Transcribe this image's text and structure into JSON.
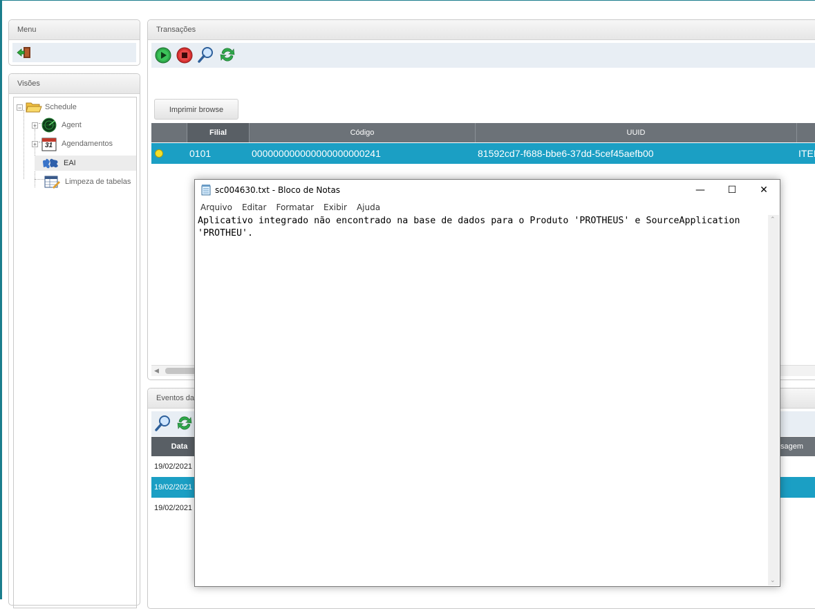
{
  "menu": {
    "title": "Menu"
  },
  "visoes": {
    "title": "Visões",
    "tree": [
      {
        "label": "Schedule",
        "icon": "folder-icon"
      },
      {
        "label": "Agent",
        "icon": "radar-icon"
      },
      {
        "label": "Agendamentos",
        "icon": "calendar-icon"
      },
      {
        "label": "EAI",
        "icon": "puzzle-icon"
      },
      {
        "label": "Limpeza de tabelas",
        "icon": "table-clean-icon"
      }
    ],
    "calendar_day": "31"
  },
  "transacoes": {
    "title": "Transações",
    "print_button": "Imprimir browse",
    "columns": [
      "Filial",
      "Código",
      "UUID",
      ""
    ],
    "rows": [
      {
        "filial": "0101",
        "codigo": "000000000000000000000241",
        "uuid": "81592cd7-f688-bbe6-37dd-5cef45aefb00",
        "extra": "ITEI"
      }
    ]
  },
  "eventos": {
    "title": "Eventos da",
    "columns": {
      "data": "Data",
      "mensagem": "sagem"
    },
    "rows": [
      "19/02/2021",
      "19/02/2021",
      "19/02/2021"
    ]
  },
  "notepad": {
    "title": "sc004630.txt - Bloco de Notas",
    "menu": [
      "Arquivo",
      "Editar",
      "Formatar",
      "Exibir",
      "Ajuda"
    ],
    "content": "Aplicativo integrado não encontrado na base de dados para o Produto 'PROTHEUS' e SourceApplication\n'PROTHEU'.",
    "controls": {
      "minimize": "—",
      "maximize": "☐",
      "close": "✕"
    }
  },
  "colors": {
    "selected_row": "#1b9fc4",
    "header_bg": "#6c7278",
    "toolbar_bg": "#e8eef4"
  }
}
